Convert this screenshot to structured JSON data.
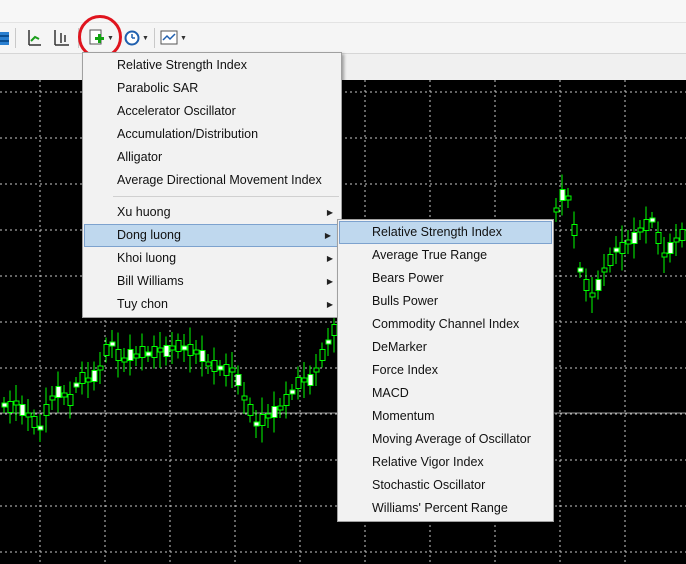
{
  "toolbar": {
    "icons": [
      "save-icon",
      "line-chart-icon",
      "bar-chart-icon",
      "add-indicator-icon",
      "clock-icon",
      "template-icon"
    ]
  },
  "colors": {
    "chart_background": "#000000",
    "candle": "#00ff00",
    "highlight_ring": "#e0141e",
    "menu_hover": "#bfd8ee"
  },
  "main_menu": {
    "items": [
      {
        "label": "Relative Strength Index"
      },
      {
        "label": "Parabolic SAR"
      },
      {
        "label": "Accelerator Oscillator"
      },
      {
        "label": "Accumulation/Distribution"
      },
      {
        "label": "Alligator"
      },
      {
        "label": "Average Directional Movement Index"
      }
    ],
    "groups": [
      {
        "label": "Xu huong",
        "submenu": true
      },
      {
        "label": "Dong luong",
        "submenu": true,
        "active": true
      },
      {
        "label": "Khoi luong",
        "submenu": true
      },
      {
        "label": "Bill Williams",
        "submenu": true
      },
      {
        "label": "Tuy chon",
        "submenu": true
      }
    ]
  },
  "sub_menu": {
    "items": [
      {
        "label": "Relative Strength Index",
        "hover": true
      },
      {
        "label": "Average True Range"
      },
      {
        "label": "Bears Power"
      },
      {
        "label": "Bulls Power"
      },
      {
        "label": "Commodity Channel Index"
      },
      {
        "label": "DeMarker"
      },
      {
        "label": "Force Index"
      },
      {
        "label": "MACD"
      },
      {
        "label": "Momentum"
      },
      {
        "label": "Moving Average of Oscillator"
      },
      {
        "label": "Relative Vigor Index"
      },
      {
        "label": "Stochastic Oscillator"
      },
      {
        "label": "Williams' Percent Range"
      }
    ]
  }
}
